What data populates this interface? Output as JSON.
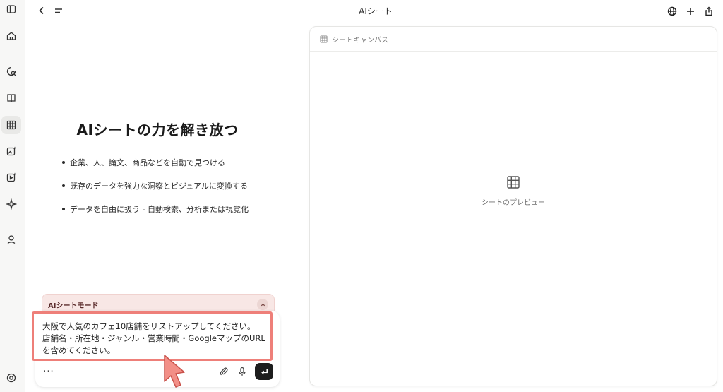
{
  "window": {
    "title": "AIシート"
  },
  "rail": {
    "items": [
      {
        "icon": "sidebar-toggle-icon"
      },
      {
        "icon": "home-icon"
      },
      {
        "icon": "chat-search-icon"
      },
      {
        "icon": "book-icon"
      },
      {
        "icon": "grid-table-icon",
        "active": true
      },
      {
        "icon": "image-sparkle-icon"
      },
      {
        "icon": "video-sparkle-icon"
      },
      {
        "icon": "sparkle-icon"
      },
      {
        "icon": "user-icon"
      },
      {
        "icon": "settings-icon"
      }
    ]
  },
  "topbar": {
    "right_icons": [
      "globe-icon",
      "plus-icon",
      "share-icon"
    ]
  },
  "hero": {
    "title": "AIシートの力を解き放つ",
    "features": [
      "企業、人、論文、商品などを自動で見つける",
      "既存のデータを強力な洞察とビジュアルに変換する",
      "データを自由に扱う - 自動検索、分析または視覚化"
    ]
  },
  "mode": {
    "label": "AIシートモード"
  },
  "composer": {
    "lines": [
      "大阪で人気のカフェ10店舗をリストアップしてください。",
      "店舗名・所在地・ジャンル・営業時間・GoogleマップのURL",
      "を含めてください。"
    ],
    "more_label": "···"
  },
  "canvas": {
    "header_label": "シートキャンバス",
    "preview_label": "シートのプレビュー"
  },
  "colors": {
    "accent_highlight": "#ee7f79",
    "mode_bg": "#f8e7e5",
    "send_button": "#1d1d1d"
  }
}
